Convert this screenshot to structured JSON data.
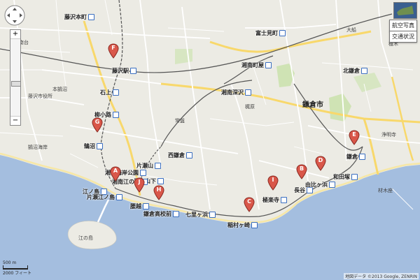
{
  "controls": {
    "aerial_label": "航空写真",
    "traffic_label": "交通状況",
    "zoom_in": "+",
    "zoom_out": "−"
  },
  "attribution": "地図データ ©2013 Google, ZENRIN",
  "scale": {
    "metric": "500 m",
    "imperial": "2000 フィート"
  },
  "colors": {
    "sea": "#a4bedf",
    "land": "#ecebe4",
    "road": "#ffffff",
    "highway": "#f8d86b",
    "rail": "#555555",
    "park": "#cfe3b4",
    "marker": "#d9574a"
  },
  "city_labels": [
    {
      "name": "city-label-kamakura",
      "text": "鎌倉市"
    }
  ],
  "stations": [
    {
      "name": "station-fujisawa",
      "text": "藤沢駅"
    },
    {
      "name": "station-ishigami",
      "text": "石上"
    },
    {
      "name": "station-yanagikoji",
      "text": "柳小路"
    },
    {
      "name": "station-kugenuma",
      "text": "鵠沼"
    },
    {
      "name": "station-shonan-kaigan-koen",
      "text": "湘南海岸公園"
    },
    {
      "name": "station-enoshima",
      "text": "江ノ島"
    },
    {
      "name": "station-koshigoe",
      "text": "腰越"
    },
    {
      "name": "station-kamakura-koko-mae",
      "text": "鎌倉高校前"
    },
    {
      "name": "station-shichirigahama",
      "text": "七里ヶ浜"
    },
    {
      "name": "station-inamuragasaki",
      "text": "稲村ヶ崎"
    },
    {
      "name": "station-gokurakuji",
      "text": "極楽寺"
    },
    {
      "name": "station-hase",
      "text": "長谷"
    },
    {
      "name": "station-yuigahama",
      "text": "由比ヶ浜"
    },
    {
      "name": "station-wadazuka",
      "text": "和田塚"
    },
    {
      "name": "station-kamakura",
      "text": "鎌倉"
    },
    {
      "name": "station-kitakamakura",
      "text": "北鎌倉"
    },
    {
      "name": "station-shonan-machiya",
      "text": "湘南町屋"
    },
    {
      "name": "station-shonan-fukasawa",
      "text": "湘南深沢"
    },
    {
      "name": "station-fujimicho",
      "text": "富士見町"
    },
    {
      "name": "station-nishi-kamakura",
      "text": "西鎌倉"
    },
    {
      "name": "station-katase-yama",
      "text": "片瀬山"
    },
    {
      "name": "station-mejiroyamashita",
      "text": "目白山下"
    },
    {
      "name": "station-shonan-enoshima",
      "text": "湘南江の島"
    },
    {
      "name": "station-katase-enoshima",
      "text": "片瀬江ノ島"
    },
    {
      "name": "station-fujisawa-honmachi",
      "text": "藤沢本町"
    }
  ],
  "place_labels": [
    {
      "name": "label-fujisawa-shiyakusho",
      "text": "藤沢市役所"
    },
    {
      "name": "label-shonan-dai",
      "text": "湘南台"
    },
    {
      "name": "label-motomachi",
      "text": "本鵠沼"
    },
    {
      "name": "label-kugenuma-kaigan",
      "text": "鵠沼海岸"
    },
    {
      "name": "label-enoshima-island",
      "text": "江の島"
    },
    {
      "name": "label-sagami-bay",
      "text": ""
    },
    {
      "name": "label-ueki",
      "text": "植木"
    },
    {
      "name": "label-kajiwara",
      "text": "梶原"
    },
    {
      "name": "label-tokiwa",
      "text": "常盤"
    },
    {
      "name": "label-ofuna",
      "text": "大船"
    },
    {
      "name": "label-jomyoji",
      "text": "浄明寺"
    },
    {
      "name": "label-zaimokuza",
      "text": "材木座"
    }
  ],
  "markers": [
    {
      "name": "marker-a",
      "letter": "A"
    },
    {
      "name": "marker-b",
      "letter": "B"
    },
    {
      "name": "marker-c",
      "letter": "C"
    },
    {
      "name": "marker-d",
      "letter": "D"
    },
    {
      "name": "marker-e",
      "letter": "E"
    },
    {
      "name": "marker-f",
      "letter": "F"
    },
    {
      "name": "marker-g",
      "letter": "G"
    },
    {
      "name": "marker-h",
      "letter": "H"
    },
    {
      "name": "marker-i",
      "letter": "I"
    },
    {
      "name": "marker-j",
      "letter": "J"
    }
  ]
}
